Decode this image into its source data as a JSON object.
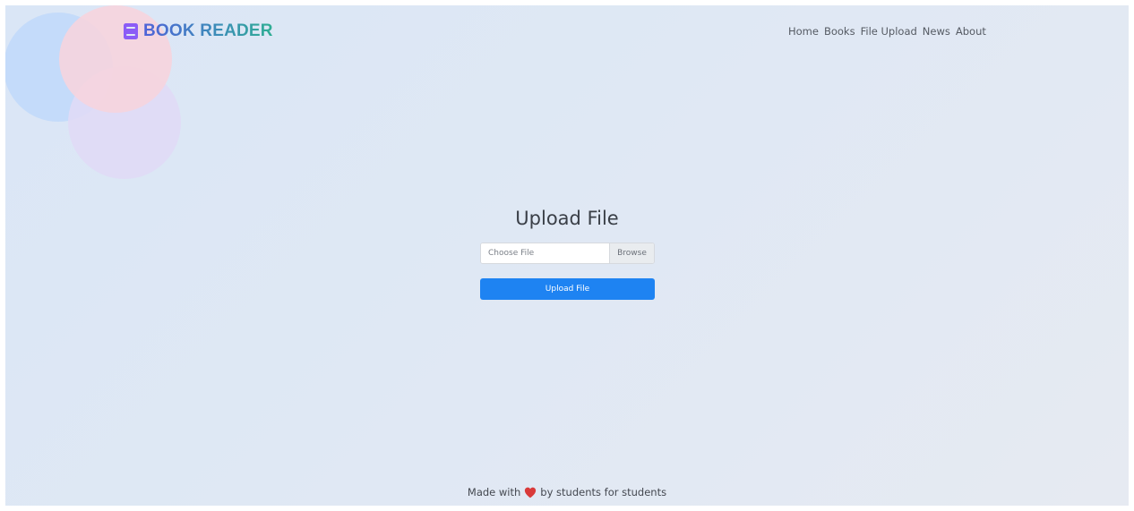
{
  "brand": {
    "name": "BOOK READER",
    "icon": "book-icon",
    "icon_color": "#8b5cf6"
  },
  "nav": {
    "items": [
      {
        "label": "Home"
      },
      {
        "label": "Books"
      },
      {
        "label": "File Upload"
      },
      {
        "label": "News"
      },
      {
        "label": "About"
      }
    ]
  },
  "upload": {
    "title": "Upload File",
    "file_placeholder": "Choose File",
    "browse_label": "Browse",
    "submit_label": "Upload File",
    "accent_color": "#1e83f2"
  },
  "footer": {
    "prefix": "Made with",
    "icon": "heart-icon",
    "icon_color": "#d93a3a",
    "suffix": "by students for students"
  }
}
